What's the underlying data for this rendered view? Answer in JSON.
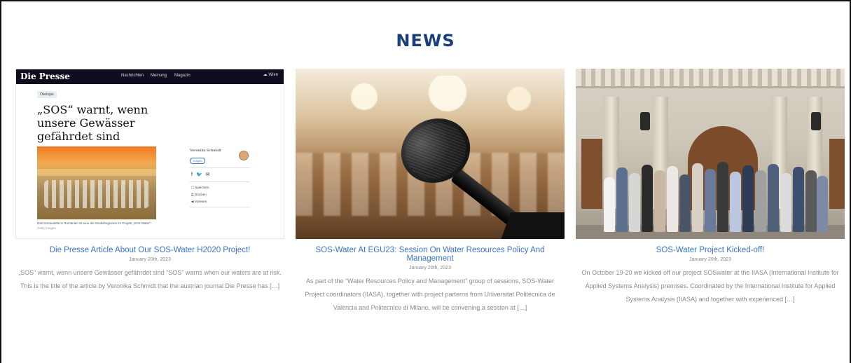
{
  "page": {
    "heading": "NEWS"
  },
  "articles": [
    {
      "title": "Die Presse Article About Our SOS-Water H2020 Project!",
      "date": "January 20th, 2023",
      "excerpt": "„SOS“ warnt, wenn unsere Gewässer gefährdet sind “SOS” warns when our waters are at risk. This is the title of the article by Veronika Schmidt that the austrian journal Die Presse has […]",
      "thumbnail": {
        "logo": "Die Presse",
        "nav": [
          "Nachrichten",
          "Meinung",
          "Magazin"
        ],
        "weather": "Wien",
        "category": "Ökologie",
        "headline": "„SOS“ warnt, wenn unsere Gewässer gefährdet sind",
        "author": "Veronika Schmidt",
        "follow": "Folgen",
        "side_options": [
          "Speichern",
          "Drucken",
          "Vorlesen"
        ],
        "caption": "Das Donaudelta in Rumänien ist eine der Modellregionen im Projekt „SOS Water“.",
        "credit": "Getty Images"
      }
    },
    {
      "title": "SOS-Water At EGU23: Session On Water Resources Policy And Management",
      "date": "January 20th, 2023",
      "excerpt": "As part of the “Water Resources Policy and Management” group of sessions, SOS-Water Project coordinators (IIASA), together with project parterns from Universitat Politècnica de València and Politecnico di Milano, will be convening a session at […]"
    },
    {
      "title": "SOS-Water Project Kicked-off!",
      "date": "January 20th, 2023",
      "excerpt": "On October 19-20 we kicked off our project SOSwater at the IIASA (International Institute for Applied Systems Analysis) premises. Coordinated by the International Institute for Applied Systems Analysis (IIASA) and together with experienced […]"
    }
  ],
  "colors": {
    "heading": "#1b3f7a",
    "link": "#3a72c8",
    "text": "#8a8a8a"
  }
}
